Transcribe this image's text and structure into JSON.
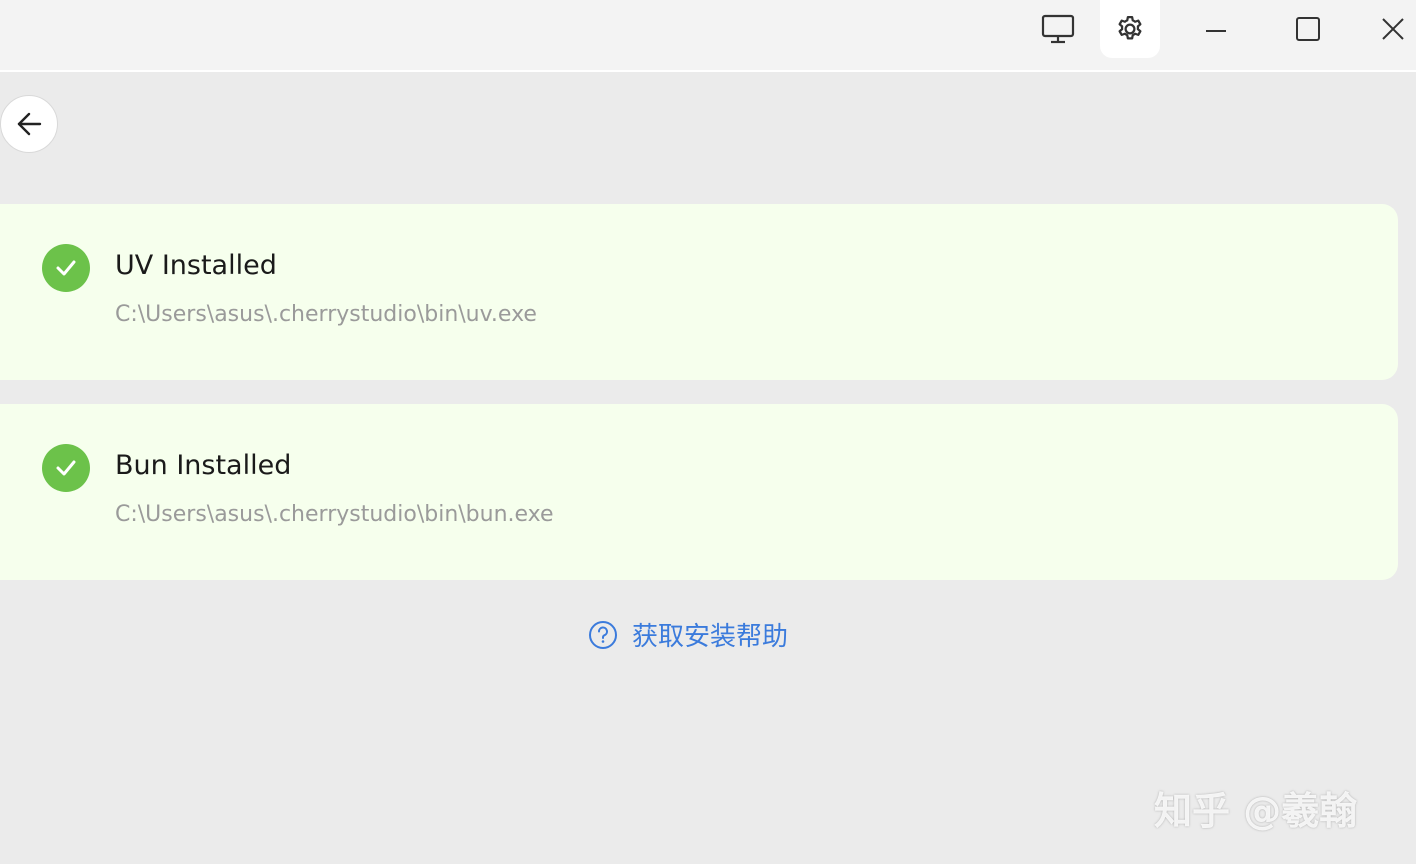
{
  "titlebar": {
    "buttons": [
      {
        "icon": "monitor-icon"
      },
      {
        "icon": "gear-icon",
        "active": true
      },
      {
        "icon": "minimize-icon"
      },
      {
        "icon": "maximize-icon"
      },
      {
        "icon": "close-icon"
      }
    ]
  },
  "back_button": {
    "icon": "arrow-left-icon"
  },
  "dependencies": [
    {
      "title": "UV Installed",
      "path": "C:\\Users\\asus\\.cherrystudio\\bin\\uv.exe",
      "status_icon": "check-circle-icon"
    },
    {
      "title": "Bun Installed",
      "path": "C:\\Users\\asus\\.cherrystudio\\bin\\bun.exe",
      "status_icon": "check-circle-icon"
    }
  ],
  "help_link": {
    "label": "获取安装帮助",
    "icon": "question-circle-icon"
  },
  "watermark": "知乎 @羲翰",
  "colors": {
    "card_bg": "#f6ffed",
    "success": "#6cc24a",
    "link": "#3b7bdc",
    "page_bg": "#ebebeb",
    "titlebar_bg": "#f3f3f3"
  }
}
